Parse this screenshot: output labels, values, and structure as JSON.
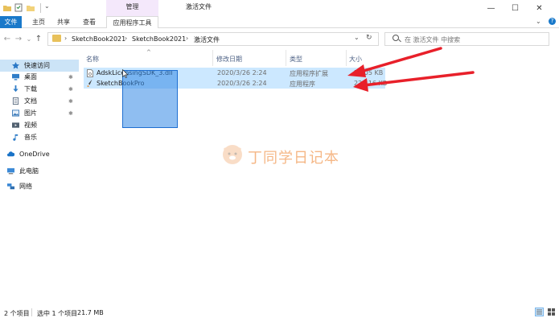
{
  "titlebar": {
    "context_group": "管理",
    "window_title": "激活文件",
    "controls": {
      "minimize": "—",
      "maximize": "☐",
      "close": "✕"
    }
  },
  "ribbon": {
    "tabs": [
      "文件",
      "主页",
      "共享",
      "查看",
      "应用程序工具"
    ],
    "expand": "⌄",
    "help": "?"
  },
  "address": {
    "back": "←",
    "forward": "→",
    "recent": "⌄",
    "up": "↑",
    "breadcrumbs": [
      "SketchBook2021",
      "SketchBook2021",
      "激活文件"
    ],
    "separator": "›",
    "dropdown": "⌄",
    "refresh": "↻"
  },
  "search": {
    "placeholder": "在 激活文件 中搜索"
  },
  "nav": {
    "items": [
      {
        "label": "快速访问",
        "icon": "star-icon",
        "pinned": false
      },
      {
        "label": "桌面",
        "icon": "desktop-icon",
        "pinned": true
      },
      {
        "label": "下载",
        "icon": "download-icon",
        "pinned": true
      },
      {
        "label": "文档",
        "icon": "document-icon",
        "pinned": true
      },
      {
        "label": "图片",
        "icon": "picture-icon",
        "pinned": true
      },
      {
        "label": "视频",
        "icon": "video-icon",
        "pinned": false
      },
      {
        "label": "音乐",
        "icon": "music-icon",
        "pinned": false
      },
      {
        "label": "OneDrive",
        "icon": "cloud-icon",
        "pinned": false
      },
      {
        "label": "此电脑",
        "icon": "pc-icon",
        "pinned": false
      },
      {
        "label": "网络",
        "icon": "network-icon",
        "pinned": false
      }
    ],
    "pin_glyph": "✱"
  },
  "columns": {
    "name": "名称",
    "modified": "修改日期",
    "type": "类型",
    "size": "大小",
    "sort_glyph": "^"
  },
  "files": [
    {
      "name": "AdskLicensingSDK_3.dll",
      "modified": "2020/3/26 2:24",
      "type": "应用程序扩展",
      "size": "5,805 KB",
      "icon": "dll-file-icon"
    },
    {
      "name": "SketchBookPro",
      "modified": "2020/3/26 2:24",
      "type": "应用程序",
      "size": "22,416 KB",
      "icon": "app-file-icon"
    }
  ],
  "watermark": {
    "text": "丁同学日记本"
  },
  "status": {
    "count": "2 个项目",
    "selected": "选中 1 个项目",
    "size": "21.7 MB"
  },
  "colors": {
    "accent": "#1979ca",
    "selection": "#cce8ff",
    "arrow": "#e8202a"
  }
}
